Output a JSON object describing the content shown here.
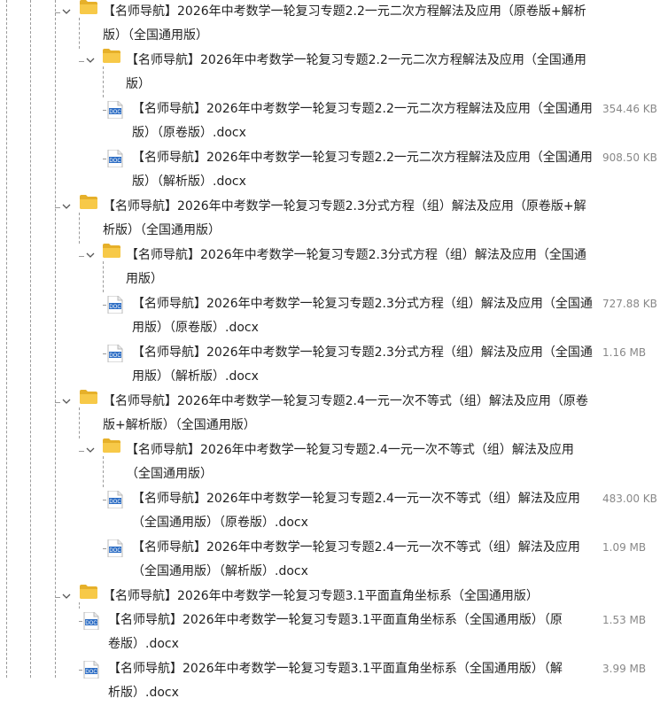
{
  "colors": {
    "folder": "#f7c948",
    "folder_dark": "#e6b02a",
    "doc_blue": "#2b6cc4",
    "size_text": "#888888"
  },
  "icons": {
    "expanded": "chevron-down-icon",
    "folder": "folder-icon",
    "file": "word-doc-icon"
  },
  "rows": [
    {
      "type": "folder",
      "level": 1,
      "label": "【名师导航】2026年中考数学一轮复习专题2.2一元二次方程解法及应用（原卷版+解析版）（全国通用版）"
    },
    {
      "type": "folder",
      "level": 2,
      "label": "【名师导航】2026年中考数学一轮复习专题2.2一元二次方程解法及应用（全国通用版）"
    },
    {
      "type": "file",
      "level": 3,
      "label": "【名师导航】2026年中考数学一轮复习专题2.2一元二次方程解法及应用（全国通用版）（原卷版）.docx",
      "size": "354.46 KB"
    },
    {
      "type": "file",
      "level": 3,
      "label": "【名师导航】2026年中考数学一轮复习专题2.2一元二次方程解法及应用（全国通用版）（解析版）.docx",
      "size": "908.50 KB"
    },
    {
      "type": "folder",
      "level": 1,
      "label": "【名师导航】2026年中考数学一轮复习专题2.3分式方程（组）解法及应用（原卷版+解析版）（全国通用版）"
    },
    {
      "type": "folder",
      "level": 2,
      "label": "【名师导航】2026年中考数学一轮复习专题2.3分式方程（组）解法及应用（全国通用版）"
    },
    {
      "type": "file",
      "level": 3,
      "label": "【名师导航】2026年中考数学一轮复习专题2.3分式方程（组）解法及应用（全国通用版）（原卷版）.docx",
      "size": "727.88 KB"
    },
    {
      "type": "file",
      "level": 3,
      "label": "【名师导航】2026年中考数学一轮复习专题2.3分式方程（组）解法及应用（全国通用版）（解析版）.docx",
      "size": "1.16 MB"
    },
    {
      "type": "folder",
      "level": 1,
      "label": "【名师导航】2026年中考数学一轮复习专题2.4一元一次不等式（组）解法及应用（原卷版+解析版）（全国通用版）"
    },
    {
      "type": "folder",
      "level": 2,
      "label": "【名师导航】2026年中考数学一轮复习专题2.4一元一次不等式（组）解法及应用（全国通用版）"
    },
    {
      "type": "file",
      "level": 3,
      "label": "【名师导航】2026年中考数学一轮复习专题2.4一元一次不等式（组）解法及应用（全国通用版）（原卷版）.docx",
      "size": "483.00 KB"
    },
    {
      "type": "file",
      "level": 3,
      "label": "【名师导航】2026年中考数学一轮复习专题2.4一元一次不等式（组）解法及应用（全国通用版）（解析版）.docx",
      "size": "1.09 MB"
    },
    {
      "type": "folder",
      "level": 1,
      "label": "【名师导航】2026年中考数学一轮复习专题3.1平面直角坐标系（全国通用版）"
    },
    {
      "type": "file",
      "level": 2,
      "label": "【名师导航】2026年中考数学一轮复习专题3.1平面直角坐标系（全国通用版）（原卷版）.docx",
      "size": "1.53 MB"
    },
    {
      "type": "file",
      "level": 2,
      "label": "【名师导航】2026年中考数学一轮复习专题3.1平面直角坐标系（全国通用版）（解析版）.docx",
      "size": "3.99 MB"
    }
  ]
}
